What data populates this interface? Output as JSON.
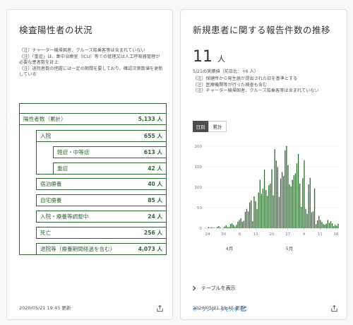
{
  "left": {
    "title": "検査陽性者の状況",
    "notes": [
      "（注）チャーター機帰国者、クルーズ船乗客等は含まれていない",
      "（注）「重症」は、集中治療室（ICU）等での管理又は人工呼吸器管理が必要な患者数を計上",
      "（注）退院者数の把握には一定の期間を要しており、確認次第数値を更新している"
    ],
    "tree": {
      "positive": {
        "label": "陽性者数（累計）",
        "value": "5,133 人"
      },
      "hospitalized": {
        "label": "入院",
        "value": "655 人"
      },
      "mild": {
        "label": "軽症・中等症",
        "value": "613 人"
      },
      "severe": {
        "label": "重症",
        "value": "42 人"
      },
      "hotel": {
        "label": "宿泊療養",
        "value": "40 人"
      },
      "home": {
        "label": "自宅療養",
        "value": "85 人"
      },
      "adjusting": {
        "label": "入院・療養等調整中",
        "value": "24 人"
      },
      "deaths": {
        "label": "死亡",
        "value": "256 人"
      },
      "discharged": {
        "label": "退院等（療養期間経過を含む）",
        "value": "4,073 人"
      }
    },
    "footer_date": "2020/05/21 19:45 更新"
  },
  "right": {
    "title": "新規患者に関する報告件数の推移",
    "big_number": "11",
    "big_unit": "人",
    "date_line": "5/21の実績値（前日比：+6 人）",
    "notes": [
      "（注）保健所から発生届が提出された日を基準とする",
      "（注）医療機関等が行った検査も含む",
      "（注）チャーター機帰国者、クルーズ船乗客等は含まれていない"
    ],
    "toggle_daily": "日別",
    "toggle_cumulative": "累計",
    "table_toggle": "テーブルを表示",
    "open_data": "オープンデータを入手",
    "footer_date": "2020/05/21 19:45 更新"
  },
  "chart_data": {
    "type": "bar",
    "ylim": [
      0,
      200
    ],
    "yticks": [
      0,
      50,
      100,
      150,
      200
    ],
    "tick_labels": [
      "2/22",
      "24",
      "26",
      "28",
      "3/2",
      "4",
      "6",
      "8",
      "10",
      "12",
      "14",
      "16",
      "18",
      "20",
      "22",
      "24",
      "26",
      "28",
      "30",
      "4/1",
      "3",
      "5",
      "7",
      "9",
      "11",
      "13",
      "15",
      "17",
      "19",
      "21",
      "23",
      "25",
      "27",
      "29",
      "5/1",
      "3",
      "5",
      "7",
      "9",
      "11",
      "13",
      "15",
      "17",
      "19",
      "21"
    ],
    "axis_labels_printed": [
      "24",
      "30",
      "6",
      "13",
      "20",
      "27",
      "4",
      "11",
      "18"
    ],
    "month_labels": [
      "4月",
      "5月"
    ],
    "color": "#2e6930",
    "values": [
      1,
      0,
      3,
      1,
      2,
      1,
      1,
      0,
      3,
      5,
      2,
      0,
      1,
      4,
      7,
      3,
      3,
      10,
      12,
      8,
      4,
      8,
      16,
      20,
      24,
      16,
      18,
      40,
      47,
      41,
      63,
      68,
      17,
      78,
      66,
      47,
      87,
      118,
      84,
      97,
      143,
      93,
      79,
      105,
      109,
      144,
      80,
      193,
      165,
      149,
      76,
      121,
      137,
      127,
      190,
      201,
      154,
      107,
      102,
      118,
      129,
      134,
      158,
      181,
      109,
      52,
      122,
      166,
      47,
      35,
      107,
      123,
      39,
      41,
      97,
      10,
      19,
      30,
      20,
      15,
      10,
      9,
      11,
      20,
      13,
      17,
      12,
      5,
      9,
      6,
      11
    ]
  }
}
